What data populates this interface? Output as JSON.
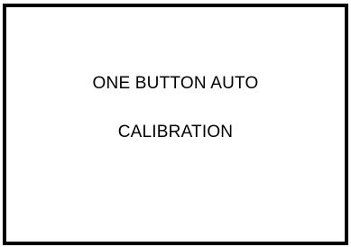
{
  "display": {
    "line1": "ONE BUTTON AUTO",
    "line2": "CALIBRATION"
  },
  "colors": {
    "border": "#000000",
    "background": "#ffffff",
    "text": "#000000"
  }
}
